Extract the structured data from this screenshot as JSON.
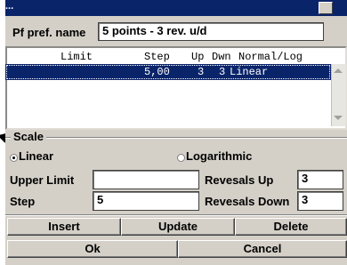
{
  "title_fragment": "...",
  "pref_name": {
    "label": "Pf pref. name",
    "value": "5 points - 3 rev. u/d"
  },
  "list": {
    "headers": [
      "Limit",
      "Step",
      "Up",
      "Dwn",
      "Normal/Log"
    ],
    "rows": [
      {
        "limit": "",
        "step": "5,00",
        "up": "3",
        "dwn": "3",
        "mode": "Linear"
      }
    ]
  },
  "scale": {
    "title": "Scale",
    "options": [
      "Linear",
      "Logarithmic"
    ],
    "selected": "Linear"
  },
  "fields": {
    "upper_limit": {
      "label": "Upper Limit",
      "value": ""
    },
    "step": {
      "label": "Step",
      "value": "5"
    },
    "reversals_up": {
      "label": "Revesals Up",
      "value": "3"
    },
    "reversals_down": {
      "label": "Revesals Down",
      "value": "3"
    }
  },
  "buttons": {
    "insert": "Insert",
    "update": "Update",
    "delete": "Delete",
    "ok": "Ok",
    "cancel": "Cancel"
  },
  "colors": {
    "selection": "#0a246a",
    "face": "#d4d0c8"
  }
}
